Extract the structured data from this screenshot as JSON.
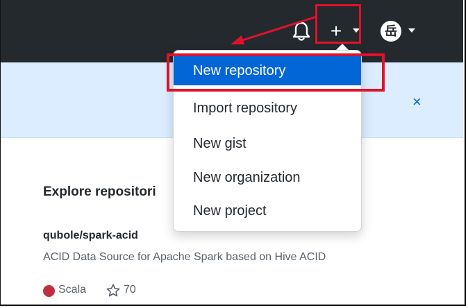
{
  "header": {
    "bell_icon": "bell-icon",
    "plus_label": "+",
    "avatar_text": "岳"
  },
  "banner": {
    "close_label": "×"
  },
  "dropdown": {
    "items": [
      {
        "label": "New repository",
        "active": true
      },
      {
        "label": "Import repository"
      },
      {
        "label": "New gist"
      },
      {
        "label": "New organization"
      },
      {
        "label": "New project"
      }
    ]
  },
  "explore": {
    "heading": "Explore repositori",
    "repo": {
      "name": "qubole/spark-acid",
      "description": "ACID Data Source for Apache Spark based on Hive ACID",
      "language": "Scala",
      "stars": "70"
    }
  },
  "colors": {
    "header_bg": "#24292e",
    "accent": "#0366d6",
    "highlight": "#e0122b",
    "banner_bg": "#dbedff",
    "scala_color": "#c22d40"
  }
}
